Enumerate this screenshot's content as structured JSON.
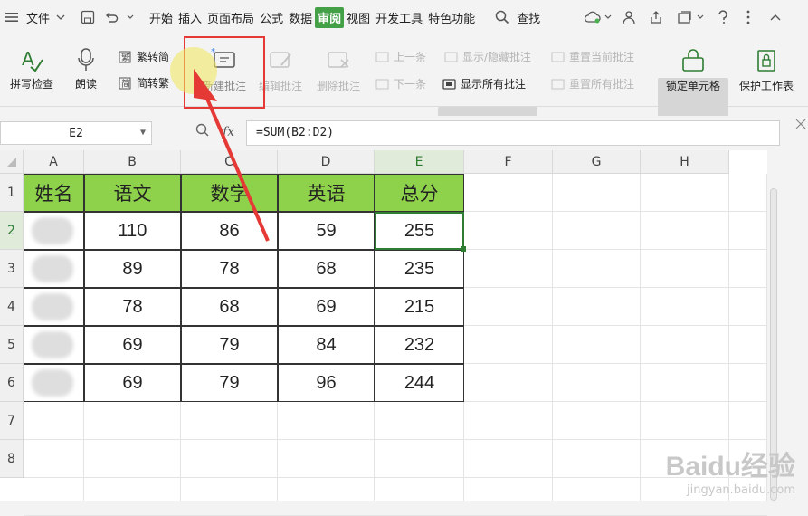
{
  "menu": {
    "file": "文件",
    "tabs": [
      "开始",
      "插入",
      "页面布局",
      "公式",
      "数据",
      "审阅",
      "视图",
      "开发工具",
      "特色功能"
    ],
    "active_tab": "审阅",
    "search": "查找"
  },
  "ribbon": {
    "spellcheck": "拼写检查",
    "read_aloud": "朗读",
    "to_traditional": "繁转简",
    "to_simplified": "简转繁",
    "new_comment": "新建批注",
    "edit_comment": "编辑批注",
    "delete_comment": "删除批注",
    "prev": "上一条",
    "next": "下一条",
    "show_hide": "显示/隐藏批注",
    "show_all": "显示所有批注",
    "reset_current": "重置当前批注",
    "reset_all": "重置所有批注",
    "lock_cell": "锁定单元格",
    "protect_sheet": "保护工作表"
  },
  "formula_bar": {
    "cell_ref": "E2",
    "fx": "fx",
    "formula": "=SUM(B2:D2)"
  },
  "sheet": {
    "columns": [
      "A",
      "B",
      "C",
      "D",
      "E",
      "F",
      "G",
      "H"
    ],
    "rows": [
      "1",
      "2",
      "3",
      "4",
      "5",
      "6",
      "7",
      "8"
    ],
    "headers": [
      "姓名",
      "语文",
      "数学",
      "英语",
      "总分"
    ],
    "data": [
      [
        "",
        "110",
        "86",
        "59",
        "255"
      ],
      [
        "",
        "89",
        "78",
        "68",
        "235"
      ],
      [
        "",
        "78",
        "68",
        "69",
        "215"
      ],
      [
        "",
        "69",
        "79",
        "84",
        "232"
      ],
      [
        "",
        "69",
        "79",
        "96",
        "244"
      ]
    ],
    "selected_cell": "E2"
  },
  "watermark": {
    "brand": "Baidu经验",
    "url": "jingyan.baidu.com"
  },
  "colors": {
    "header_fill": "#8ed14a",
    "active_tab": "#43a047",
    "highlight_box": "#e53935",
    "arrow": "#e53935"
  }
}
